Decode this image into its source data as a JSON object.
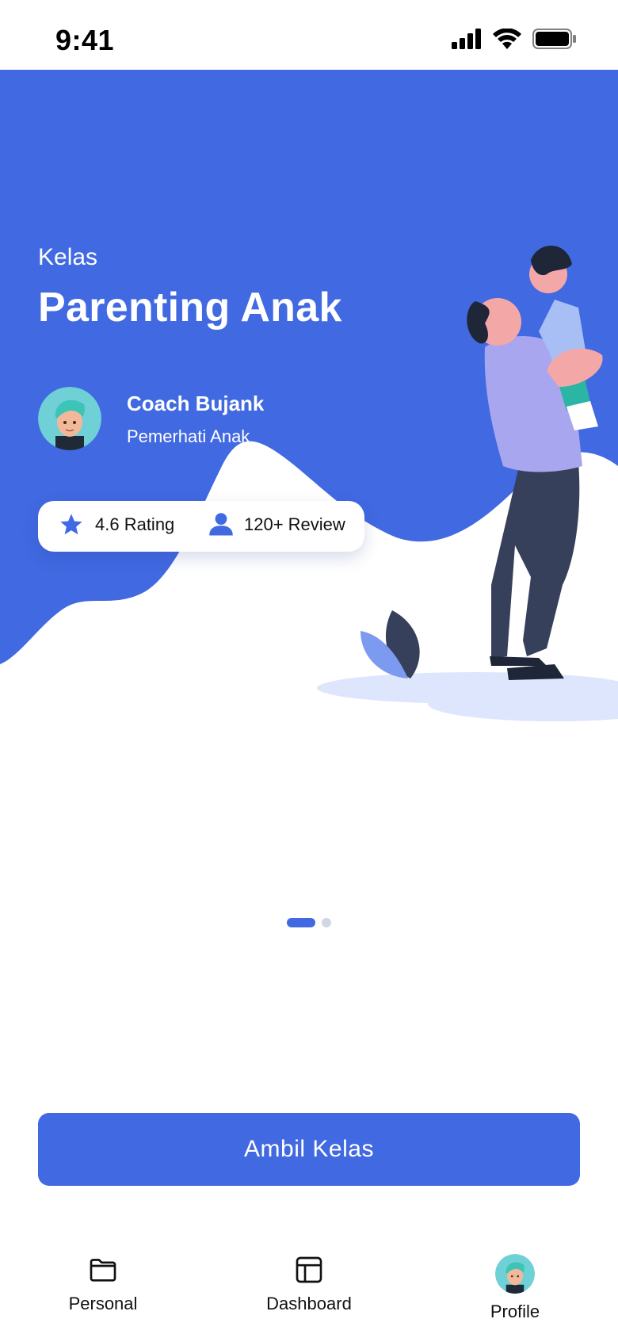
{
  "status_bar": {
    "time": "9:41"
  },
  "hero": {
    "subtitle": "Kelas",
    "title": "Parenting Anak",
    "coach": {
      "name": "Coach Bujank",
      "role": "Pemerhati Anak"
    },
    "stats": {
      "rating": "4.6 Rating",
      "review": "120+ Review"
    }
  },
  "pager": {
    "total": 2,
    "active": 1
  },
  "cta": {
    "label": "Ambil Kelas"
  },
  "nav": [
    {
      "label": "Personal",
      "icon": "folder-icon"
    },
    {
      "label": "Dashboard",
      "icon": "dashboard-icon"
    },
    {
      "label": "Profile",
      "icon": "avatar"
    }
  ],
  "colors": {
    "primary": "#4169E1",
    "light_blue": "#DDE6FD",
    "purple": "#A7A6EE",
    "navy": "#36405A"
  }
}
